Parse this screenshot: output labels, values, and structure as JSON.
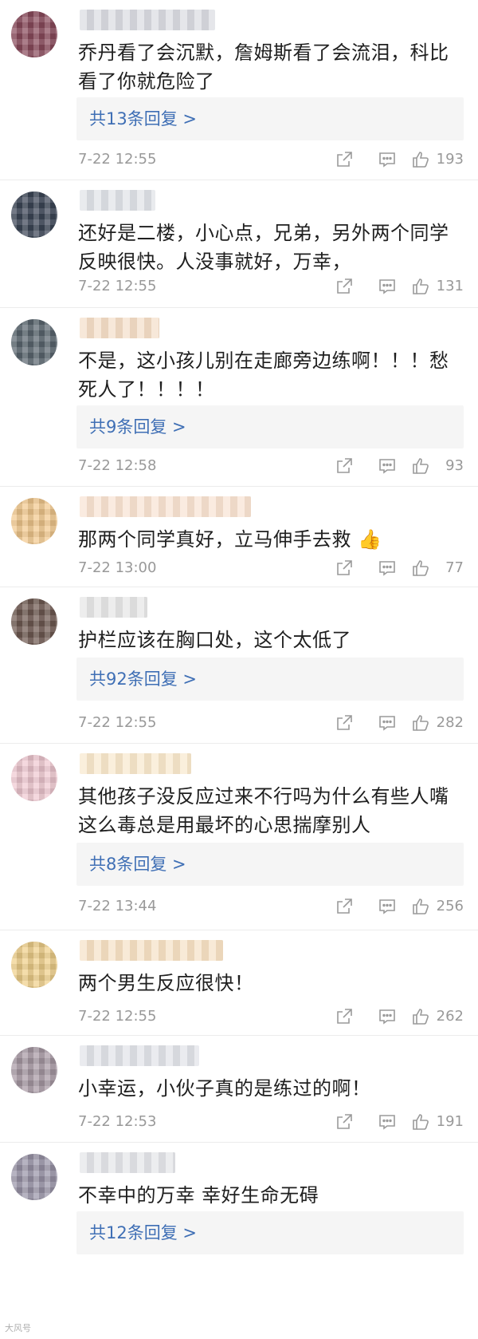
{
  "comments": [
    {
      "text": "乔丹看了会沉默，詹姆斯看了会流泪，科比\n看了你就危险了",
      "replies": "共13条回复 >",
      "time": "7-22 12:55",
      "likes": "193",
      "avatar_color": "#8a4b5c",
      "name_color": "#d7d9df"
    },
    {
      "text": "还好是二楼，小心点，兄弟，另外两个同学\n反映很快。人没事就好，万幸，",
      "replies": "",
      "time": "7-22 12:55",
      "likes": "131",
      "avatar_color": "#3c4656",
      "name_color": "#dde0e5"
    },
    {
      "text": "不是，这小孩儿别在走廊旁边练啊！！！愁\n死人了！！！！",
      "replies": "共9条回复 >",
      "time": "7-22 12:58",
      "likes": "93",
      "avatar_color": "#5b6770",
      "name_color": "#f3dcc5"
    },
    {
      "text": "那两个同学真好，立马伸手去救",
      "emoji": "👍",
      "replies": "",
      "time": "7-22 13:00",
      "likes": "77",
      "avatar_color": "#f2c98e",
      "name_color": "#f7e1cf"
    },
    {
      "text": "护栏应该在胸口处，这个太低了",
      "replies": "共92条回复 >",
      "time": "7-22 12:55",
      "likes": "282",
      "avatar_color": "#6f5a52",
      "name_color": "#e4e4e4"
    },
    {
      "text": "其他孩子没反应过来不行吗为什么有些人嘴\n这么毒总是用最坏的心思揣摩别人",
      "replies": "共8条回复 >",
      "time": "7-22 13:44",
      "likes": "256",
      "avatar_color": "#f0c9d2",
      "name_color": "#f7e6ca"
    },
    {
      "text": "两个男生反应很快！",
      "replies": "",
      "time": "7-22 12:55",
      "likes": "262",
      "avatar_color": "#efcf8a",
      "name_color": "#f5dfc2"
    },
    {
      "text": "小幸运，小伙子真的是练过的啊！",
      "replies": "",
      "time": "7-22 12:53",
      "likes": "191",
      "avatar_color": "#a89aa5",
      "name_color": "#dfe1e6"
    },
    {
      "text": "不幸中的万幸 幸好生命无碍",
      "replies": "共12条回复 >",
      "time": "",
      "likes": "",
      "avatar_color": "#9a95a8",
      "name_color": "#e2e3e7"
    }
  ],
  "icons": {
    "share": "share-icon",
    "comment": "comment-icon",
    "like": "thumbs-up-icon"
  },
  "watermark": "大风号"
}
